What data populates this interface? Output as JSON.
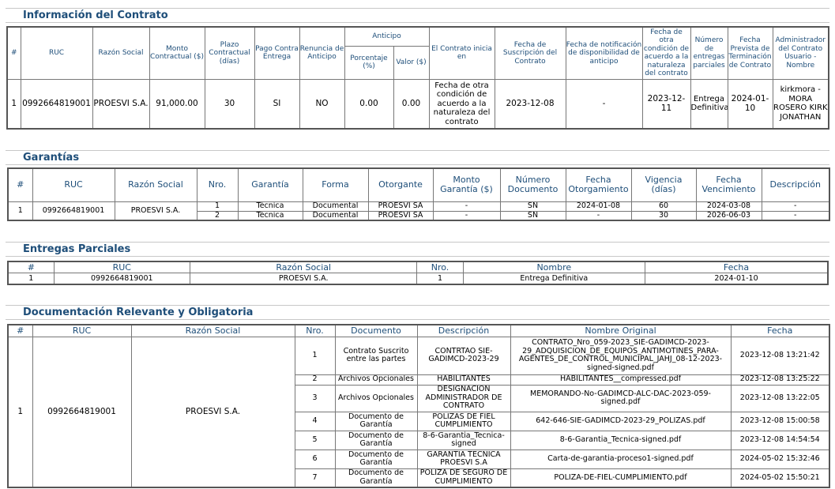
{
  "contrato": {
    "title": "Información del Contrato",
    "headers": {
      "num": "#",
      "ruc": "RUC",
      "razon": "Razón Social",
      "monto": "Monto Contractual ($)",
      "plazo": "Plazo Contractual (días)",
      "pago": "Pago Contra Entrega",
      "renuncia": "Renuncia de Anticipo",
      "anticipo": "Anticipo",
      "porcentaje": "Porcentaje (%)",
      "valor": "Valor ($)",
      "inicia": "El Contrato inicia en",
      "suscripcion": "Fecha de Suscripción del Contrato",
      "notificacion": "Fecha de notificación de disponibilidad de anticipo",
      "otra": "Fecha de otra condición de acuerdo a la naturaleza del contrato",
      "entregas": "Número de entregas parciales",
      "terminacion": "Fecha Prevista de Terminación de Contrato",
      "admin": "Administrador del Contrato Usuario - Nombre"
    },
    "row": {
      "num": "1",
      "ruc": "0992664819001",
      "razon": "PROESVI S.A.",
      "monto": "91,000.00",
      "plazo": "30",
      "pago": "SI",
      "renuncia": "NO",
      "porcentaje": "0.00",
      "valor": "0.00",
      "inicia": "Fecha de otra condición de acuerdo a la naturaleza del contrato",
      "suscripcion": "2023-12-08",
      "notificacion": "-",
      "otra": "2023-12-11",
      "entregas": "Entrega Definitiva",
      "terminacion": "2024-01-10",
      "admin": "kirkmora - MORA ROSERO KIRK JONATHAN"
    }
  },
  "garantias": {
    "title": "Garantías",
    "headers": {
      "num": "#",
      "ruc": "RUC",
      "razon": "Razón Social",
      "nro": "Nro.",
      "garantia": "Garantía",
      "forma": "Forma",
      "otorgante": "Otorgante",
      "monto": "Monto Garantía ($)",
      "documento": "Número Documento",
      "otorgamiento": "Fecha Otorgamiento",
      "vigencia": "Vigencia (días)",
      "vencimiento": "Fecha Vencimiento",
      "descripcion": "Descripción"
    },
    "num": "1",
    "ruc": "0992664819001",
    "razon": "PROESVI S.A.",
    "rows": [
      {
        "nro": "1",
        "garantia": "Técnica",
        "forma": "Documental",
        "otorgante": "PROESVI SA",
        "monto": "-",
        "documento": "SN",
        "otorgamiento": "2024-01-08",
        "vigencia": "60",
        "vencimiento": "2024-03-08",
        "descripcion": "-"
      },
      {
        "nro": "2",
        "garantia": "Técnica",
        "forma": "Documental",
        "otorgante": "PROESVI SA",
        "monto": "-",
        "documento": "SN",
        "otorgamiento": "-",
        "vigencia": "30",
        "vencimiento": "2026-06-03",
        "descripcion": "-"
      }
    ]
  },
  "entregas": {
    "title": "Entregas Parciales",
    "headers": {
      "num": "#",
      "ruc": "RUC",
      "razon": "Razón Social",
      "nro": "Nro.",
      "nombre": "Nombre",
      "fecha": "Fecha"
    },
    "row": {
      "num": "1",
      "ruc": "0992664819001",
      "razon": "PROESVI S.A.",
      "nro": "1",
      "nombre": "Entrega Definitiva",
      "fecha": "2024-01-10"
    }
  },
  "documentacion": {
    "title": "Documentación Relevante y Obligatoria",
    "headers": {
      "num": "#",
      "ruc": "RUC",
      "razon": "Razón Social",
      "nro": "Nro.",
      "documento": "Documento",
      "descripcion": "Descripción",
      "original": "Nombre Original",
      "fecha": "Fecha"
    },
    "num": "1",
    "ruc": "0992664819001",
    "razon": "PROESVI S.A.",
    "rows": [
      {
        "nro": "1",
        "documento": "Contrato Suscrito entre las partes",
        "descripcion": "CONTRTAO SIE-GADIMCD-2023-29",
        "original": "CONTRATO_Nro_059-2023_SIE-GADIMCD-2023-29_ADQUISICION_DE_EQUIPOS_ANTIMOTINES_PARA-AGENTES_DE_CONTROL_MUNICIPAL_JAHJ_08-12-2023-signed-signed.pdf",
        "fecha": "2023-12-08 13:21:42"
      },
      {
        "nro": "2",
        "documento": "Archivos Opcionales",
        "descripcion": "HABILITANTES",
        "original": "HABILITANTES__compressed.pdf",
        "fecha": "2023-12-08 13:25:22"
      },
      {
        "nro": "3",
        "documento": "Archivos Opcionales",
        "descripcion": "DESIGNACIÓN ADMINISTRADOR DE CONTRATO",
        "original": "MEMORANDO-No-GADIMCD-ALC-DAC-2023-059-signed.pdf",
        "fecha": "2023-12-08 13:22:05"
      },
      {
        "nro": "4",
        "documento": "Documento de Garantía",
        "descripcion": "PÓLIZAS DE FIEL CUMPLIMIENTO",
        "original": "642-646-SIE-GADIMCD-2023-29_POLIZAS.pdf",
        "fecha": "2023-12-08 15:00:58"
      },
      {
        "nro": "5",
        "documento": "Documento de Garantía",
        "descripcion": "8-6-Garantia_Tecnica-signed",
        "original": "8-6-Garantia_Tecnica-signed.pdf",
        "fecha": "2023-12-08 14:54:54"
      },
      {
        "nro": "6",
        "documento": "Documento de Garantía",
        "descripcion": "GARANTIA TECNICA PROESVI S.A",
        "original": "Carta-de-garantia-proceso1-signed.pdf",
        "fecha": "2024-05-02 15:32:46"
      },
      {
        "nro": "7",
        "documento": "Documento de Garantía",
        "descripcion": "POLIZA DE SEGURO DE CUMPLIMIENTO",
        "original": "POLIZA-DE-FIEL-CUMPLIMIENTO.pdf",
        "fecha": "2024-05-02 15:50:21"
      }
    ]
  }
}
